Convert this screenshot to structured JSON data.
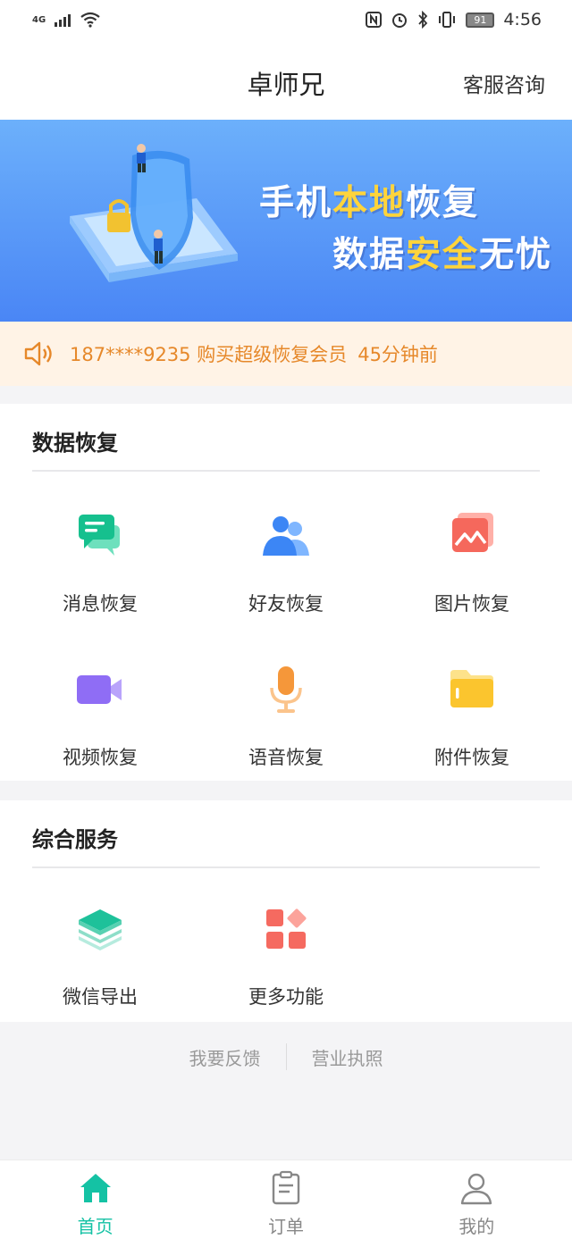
{
  "status_bar": {
    "network": "4G",
    "battery": "91",
    "time": "4:56"
  },
  "header": {
    "title": "卓师兄",
    "service_label": "客服咨询"
  },
  "banner": {
    "line1_a": "手机",
    "line1_b": "本地",
    "line1_c": "恢复",
    "line2_a": "数据",
    "line2_b": "安全",
    "line2_c": "无忧"
  },
  "notice": {
    "text": "187****9235 购买超级恢复会员",
    "time": "45分钟前"
  },
  "data_recovery": {
    "title": "数据恢复",
    "items": [
      {
        "label": "消息恢复",
        "icon": "message-icon"
      },
      {
        "label": "好友恢复",
        "icon": "friends-icon"
      },
      {
        "label": "图片恢复",
        "icon": "photo-icon"
      },
      {
        "label": "视频恢复",
        "icon": "video-icon"
      },
      {
        "label": "语音恢复",
        "icon": "microphone-icon"
      },
      {
        "label": "附件恢复",
        "icon": "folder-icon"
      }
    ]
  },
  "services": {
    "title": "综合服务",
    "items": [
      {
        "label": "微信导出",
        "icon": "layers-icon"
      },
      {
        "label": "更多功能",
        "icon": "grid-icon"
      }
    ]
  },
  "footer_links": {
    "feedback": "我要反馈",
    "license": "营业执照"
  },
  "tabbar": {
    "home": "首页",
    "orders": "订单",
    "mine": "我的",
    "active": "home"
  },
  "colors": {
    "accent": "#14c2a4",
    "banner_top": "#6cb0fb",
    "banner_bottom": "#4a86f5",
    "notice_bg": "#fff3e6",
    "notice_text": "#e6882a"
  }
}
